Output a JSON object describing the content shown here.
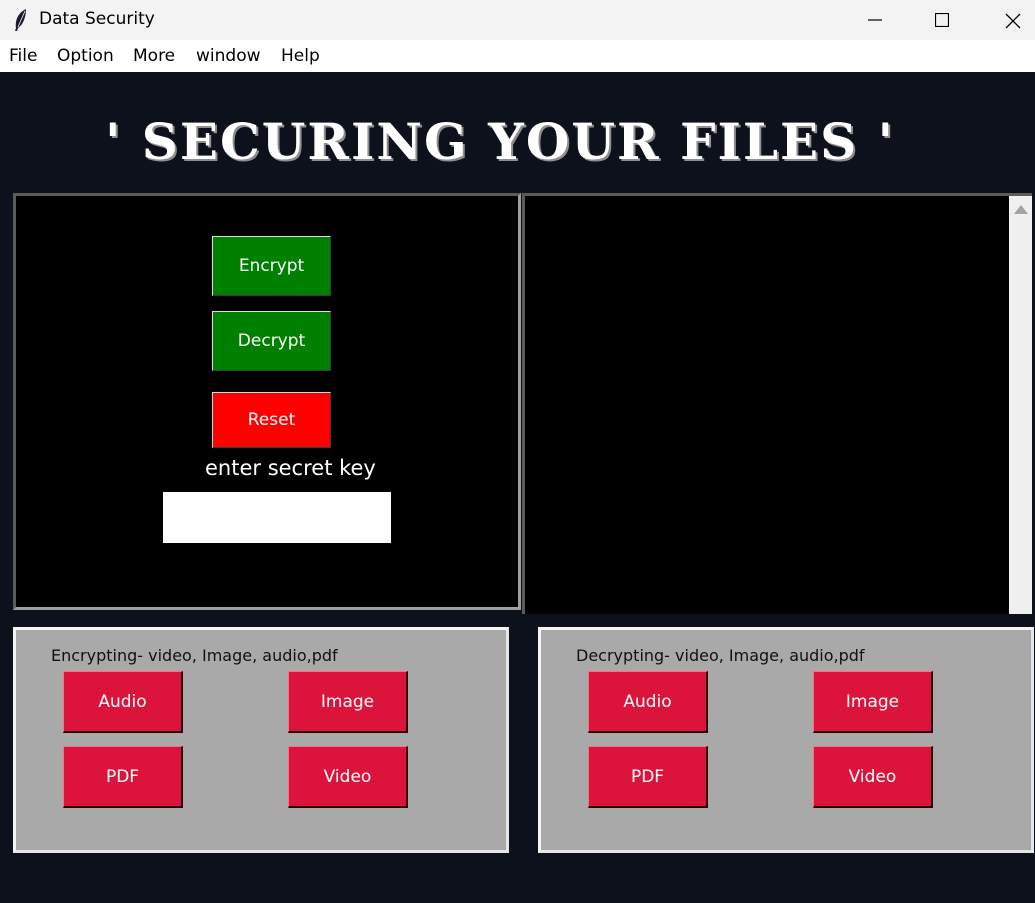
{
  "window": {
    "title": "Data Security",
    "icon": "feather-icon",
    "controls": [
      "minimize-icon",
      "maximize-icon",
      "close-icon"
    ]
  },
  "menu": [
    "File",
    "Option",
    "More",
    "window",
    "Help"
  ],
  "headline": "' SECURING YOUR FILES '",
  "left_panel": {
    "encrypt_label": "Encrypt",
    "decrypt_label": "Decrypt",
    "reset_label": "Reset",
    "key_label": "enter secret key",
    "key_value": ""
  },
  "encrypt_group": {
    "title": "Encrypting- video, Image, audio,pdf",
    "buttons": [
      "Audio",
      "Image",
      "PDF",
      "Video"
    ]
  },
  "decrypt_group": {
    "title": "Decrypting- video, Image, audio,pdf",
    "buttons": [
      "Audio",
      "Image",
      "PDF",
      "Video"
    ]
  },
  "colors": {
    "background": "#0d111c",
    "green_button": "#008000",
    "reset_button": "#ff0000",
    "file_button": "#dc143c",
    "group_bg": "#a9a9a9"
  }
}
